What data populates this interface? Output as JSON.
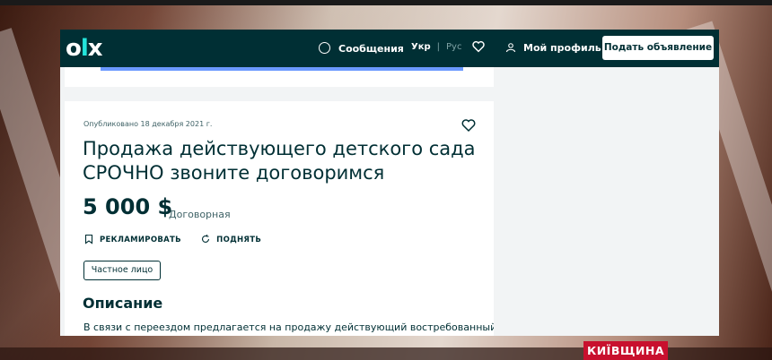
{
  "navbar": {
    "logo": "olx",
    "messages_label": "Сообщения",
    "lang_ukr": "Укр",
    "lang_sep": "|",
    "lang_rus": "Рус",
    "profile_label": "Мой профиль",
    "post_button_label": "Подать объявление"
  },
  "listing": {
    "published": "Опубликовано 18 декабря 2021 г.",
    "title": "Продажа действующего детского сада СРОЧНО звоните договоримся",
    "price": "5 000 $",
    "price_note": "Договорная",
    "promote_label": "РЕКЛАМИРОВАТЬ",
    "lift_label": "ПОДНЯТЬ",
    "seller_type": "Частное лицо",
    "description_heading": "Описание",
    "description_text": "В связи с переездом предлагается на продажу действующий востребованный"
  },
  "broadcast": {
    "channel_tag": "КИЇВЩИНА"
  },
  "colors": {
    "brand_dark": "#002f34",
    "brand_accent": "#23e5db",
    "channel_red": "#c8102e"
  }
}
